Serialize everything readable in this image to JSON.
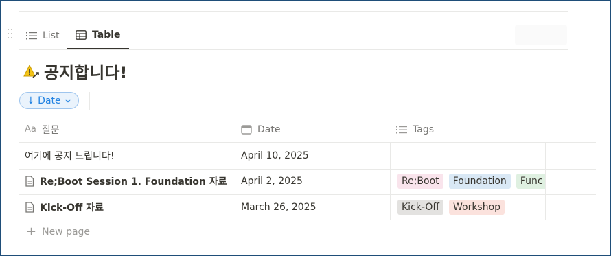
{
  "views": [
    {
      "label": "List",
      "icon": "list-icon",
      "active": false
    },
    {
      "label": "Table",
      "icon": "table-icon",
      "active": true
    }
  ],
  "page": {
    "title_emoji": "warning-icon",
    "title": "공지합니다!"
  },
  "sort": {
    "label": "↓ Date",
    "icon": "chevron-down-icon"
  },
  "columns": [
    {
      "label": "질문",
      "icon": "title-property-icon",
      "icon_text": "Aa"
    },
    {
      "label": "Date",
      "icon": "calendar-icon"
    },
    {
      "label": "Tags",
      "icon": "list-property-icon"
    }
  ],
  "rows": [
    {
      "title": "여기에 공지 드립니다!",
      "has_doc_icon": false,
      "date": "April 10, 2025",
      "tags": []
    },
    {
      "title": "Re;Boot Session 1. Foundation 자료",
      "has_doc_icon": true,
      "date": "April 2, 2025",
      "tags": [
        {
          "label": "Re;Boot",
          "bg": "#f9e4ec",
          "fg": "#37352f"
        },
        {
          "label": "Foundation",
          "bg": "#d9e8f5",
          "fg": "#37352f"
        },
        {
          "label": "Func",
          "bg": "#dff0e1",
          "fg": "#37352f"
        }
      ]
    },
    {
      "title": "Kick-Off 자료",
      "has_doc_icon": true,
      "date": "March 26, 2025",
      "tags": [
        {
          "label": "Kick-Off",
          "bg": "#e3e2e0",
          "fg": "#37352f"
        },
        {
          "label": "Workshop",
          "bg": "#fbe2dd",
          "fg": "#37352f"
        }
      ]
    }
  ],
  "new_page_label": "New page",
  "colors": {
    "accent": "#2383e2",
    "frame_border": "#1f4e79"
  }
}
